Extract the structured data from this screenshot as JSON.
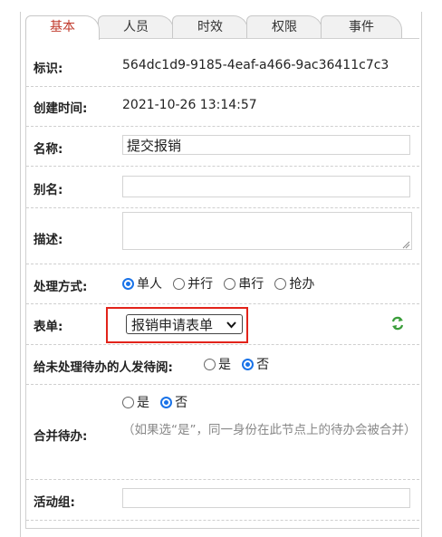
{
  "tabs": [
    "基本",
    "人员",
    "时效",
    "权限",
    "事件"
  ],
  "fields": {
    "id_label": "标识:",
    "id_value": "564dc1d9-9185-4eaf-a466-9ac36411c7c3",
    "created_label": "创建时间:",
    "created_value": "2021-10-26 13:14:57",
    "name_label": "名称:",
    "name_value": "提交报销",
    "alias_label": "别名:",
    "alias_value": "",
    "desc_label": "描述:",
    "desc_value": "",
    "mode_label": "处理方式:",
    "mode_options": [
      "单人",
      "并行",
      "串行",
      "抢办"
    ],
    "form_label": "表单:",
    "form_value": "报销申请表单",
    "notify_label": "给未处理待办的人发待阅:",
    "yes": "是",
    "no": "否",
    "merge_label": "合并待办:",
    "merge_hint": "（如果选“是”，同一身份在此节点上的待办会被合并）",
    "group_label": "活动组:",
    "group_value": ""
  },
  "colors": {
    "active_tab": "#c0392b",
    "highlight": "#e2231a",
    "radio": "#1a73e8",
    "refresh": "#3a9d3a"
  },
  "icons": {
    "refresh": "refresh-icon",
    "select_arrow": "chevron-down-icon"
  }
}
